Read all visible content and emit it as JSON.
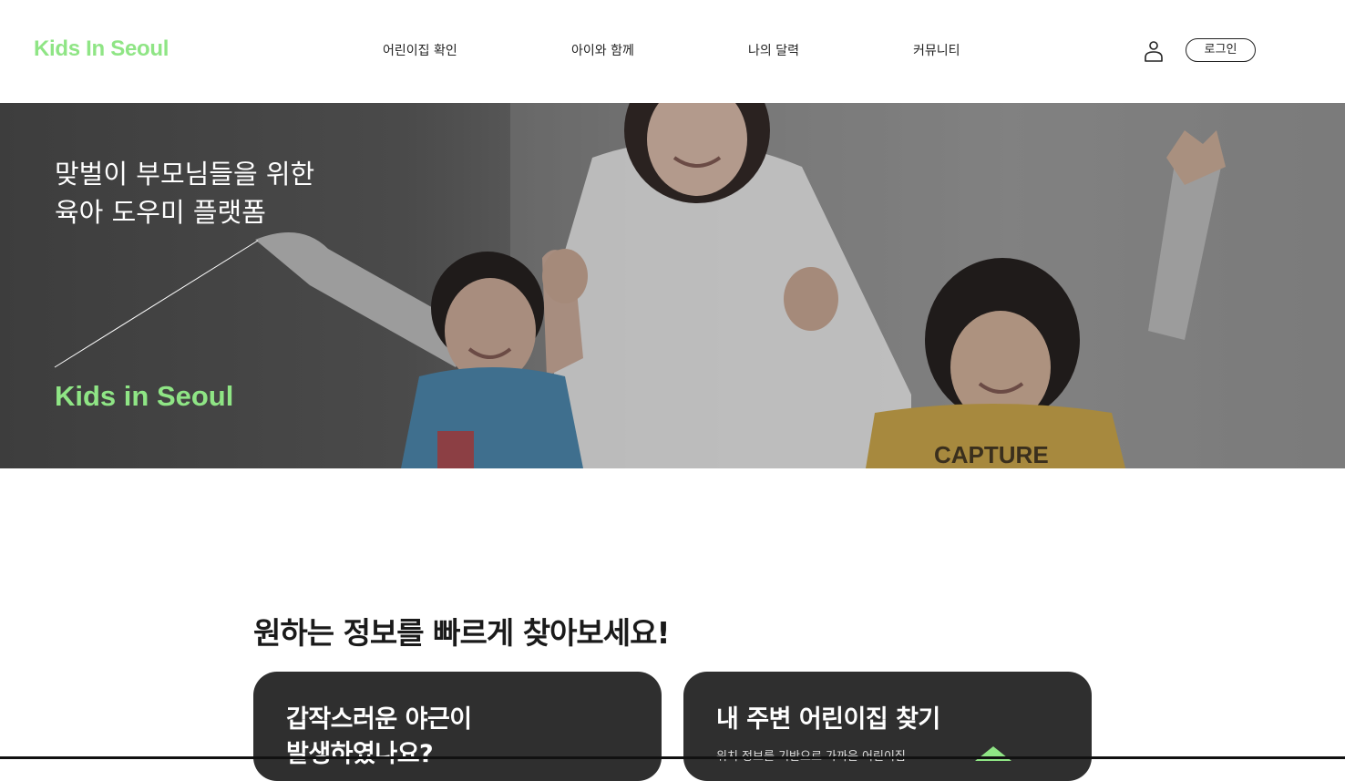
{
  "header": {
    "logo": "Kids In Seoul",
    "nav": [
      {
        "label": "어린이집 확인"
      },
      {
        "label": "아이와 함께"
      },
      {
        "label": "나의 달력"
      },
      {
        "label": "커뮤니티"
      }
    ],
    "login_label": "로그인",
    "icons": {
      "user": "user-icon"
    }
  },
  "hero": {
    "line1": "맞벌이 부모님들을 위한",
    "line2": "육아 도우미 플랫폼",
    "brand": "Kids in Seoul",
    "image": "mother-with-two-children-photo"
  },
  "section": {
    "title": "원하는 정보를 빠르게 찾아보세요!",
    "cards": [
      {
        "title_line1": "갑작스러운 야근이",
        "title_line2": "발생하였나요?"
      },
      {
        "title_line1": "내 주변 어린이집 찾기",
        "desc": "위치 정보를 기반으로 가까운 어린이집"
      }
    ]
  },
  "colors": {
    "brand_green": "#8fe585",
    "card_bg": "#2f2f2f",
    "text_dark": "#222222"
  }
}
